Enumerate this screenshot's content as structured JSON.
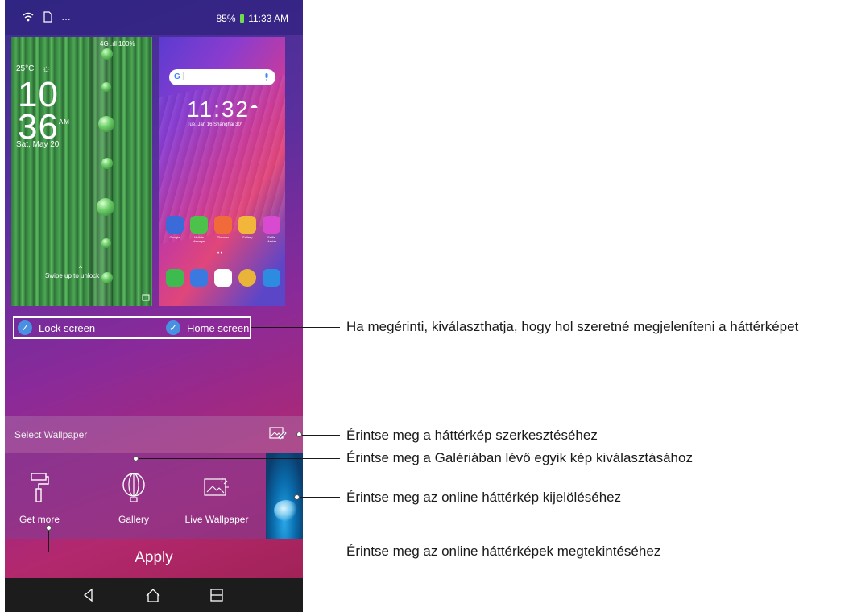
{
  "statusbar": {
    "battery": "85%",
    "time": "11:33 AM"
  },
  "lock_preview": {
    "temp": "25°C",
    "signal": "4G .ıll 100%",
    "hour": "10",
    "minute": "36",
    "ampm": "AM",
    "date": "Sat, May 20",
    "swipe": "Swipe up to unlock"
  },
  "home_preview": {
    "clock": "11:32",
    "date": "Tue, Jan 16   Shanghai  30°",
    "apps": [
      {
        "label": "Google",
        "color": "#3a6bd8"
      },
      {
        "label": "Mobile Manager",
        "color": "#4cc24a"
      },
      {
        "label": "Themes",
        "color": "#f06a3a"
      },
      {
        "label": "Gallery",
        "color": "#f2b73a"
      },
      {
        "label": "Selfie Master",
        "color": "#d84ad0"
      }
    ],
    "dock": [
      {
        "name": "phone",
        "color": "#3dbb4f"
      },
      {
        "name": "messages",
        "color": "#3a7ae0"
      },
      {
        "name": "play-store",
        "color": "#ffffff"
      },
      {
        "name": "chrome",
        "color": "#e8b53a"
      },
      {
        "name": "camera",
        "color": "#2d8be0"
      }
    ]
  },
  "selection": {
    "lock_label": "Lock screen",
    "home_label": "Home screen"
  },
  "select_wallpaper": "Select Wallpaper",
  "options": {
    "get_more": "Get more",
    "gallery": "Gallery",
    "live": "Live Wallpaper"
  },
  "apply": "Apply",
  "callouts": {
    "c1": "Ha megérinti, kiválaszthatja, hogy hol szeretné megjeleníteni a háttérképet",
    "c2": "Érintse meg a háttérkép szerkesztéséhez",
    "c3": "Érintse meg a Galériában lévő egyik kép kiválasztásához",
    "c4": "Érintse meg az online háttérkép kijelöléséhez",
    "c5": "Érintse meg az online háttérképek megtekintéséhez"
  }
}
